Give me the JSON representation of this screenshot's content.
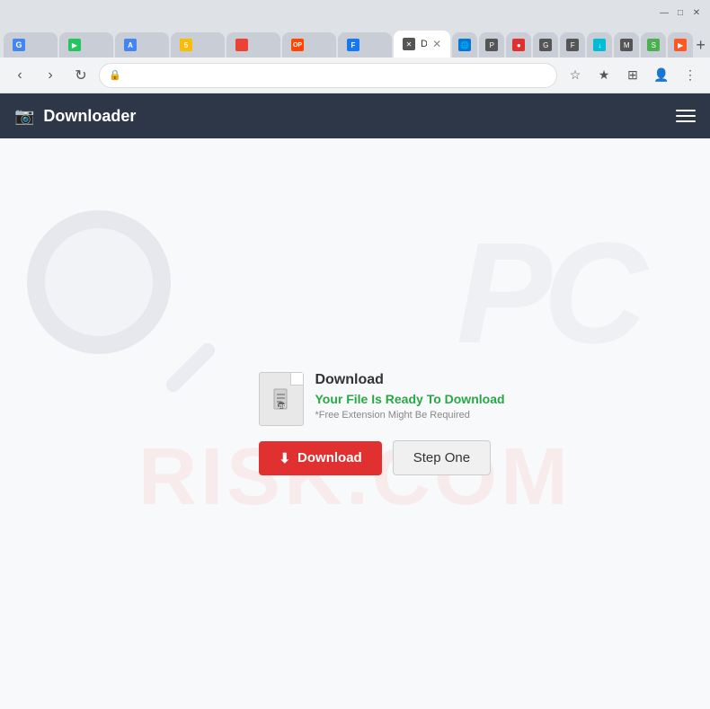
{
  "browser": {
    "title_bar": {
      "minimize": "—",
      "maximize": "□",
      "close": "✕"
    },
    "tabs": [
      {
        "id": "tab-g",
        "label": "G",
        "color": "fav-g",
        "active": false
      },
      {
        "id": "tab-play",
        "label": "▶",
        "color": "fav-green",
        "active": false
      },
      {
        "id": "tab-a",
        "label": "A",
        "color": "fav-blue-a",
        "active": false
      },
      {
        "id": "tab-s",
        "label": "5",
        "color": "fav-s",
        "active": false
      },
      {
        "id": "tab-red",
        "label": "●",
        "color": "fav-red",
        "active": false
      },
      {
        "id": "tab-op",
        "label": "OP",
        "color": "fav-op",
        "active": false
      },
      {
        "id": "tab-f",
        "label": "F",
        "color": "fav-f",
        "active": false
      },
      {
        "id": "tab-x",
        "label": "✕",
        "color": "fav-x",
        "active": true,
        "title": "Downloader"
      }
    ],
    "address": "",
    "lock_icon": "🔒"
  },
  "header": {
    "icon": "📷",
    "title": "Downloader",
    "menu_icon": "≡"
  },
  "watermarks": {
    "bottom_text": "RISK.COM",
    "pc_text": "PC"
  },
  "download_card": {
    "file_icon_char": "📎",
    "title": "Download",
    "ready_text": "Your File Is Ready To Download",
    "note": "*Free Extension Might Be Required",
    "download_btn_label": "Download",
    "download_icon": "⬇",
    "step_one_label": "Step One"
  }
}
